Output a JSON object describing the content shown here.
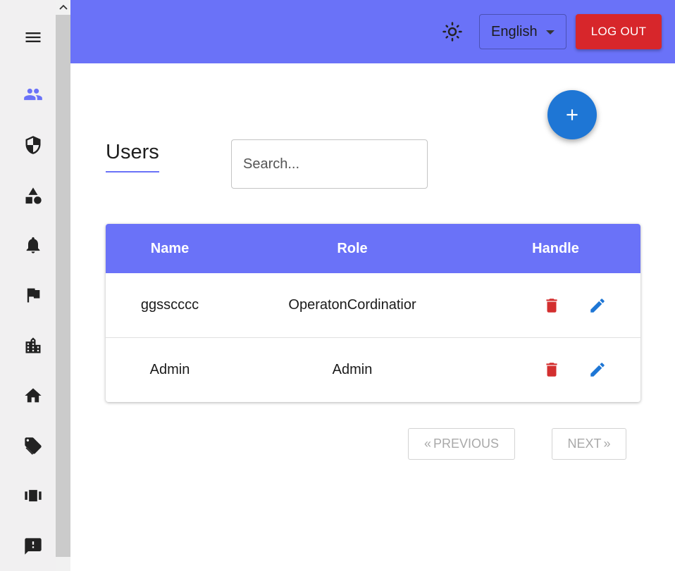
{
  "header": {
    "language": "English",
    "logout_label": "LOG OUT"
  },
  "sidebar": {
    "items": [
      {
        "icon": "menu-icon"
      },
      {
        "icon": "users-icon",
        "active": true
      },
      {
        "icon": "shield-icon"
      },
      {
        "icon": "shapes-icon"
      },
      {
        "icon": "bell-icon"
      },
      {
        "icon": "flag-icon"
      },
      {
        "icon": "city-icon"
      },
      {
        "icon": "home-icon"
      },
      {
        "icon": "tags-icon"
      },
      {
        "icon": "badge-icon"
      },
      {
        "icon": "feedback-icon"
      }
    ]
  },
  "page": {
    "title": "Users",
    "search_placeholder": "Search..."
  },
  "table": {
    "headers": {
      "name": "Name",
      "role": "Role",
      "handle": "Handle"
    },
    "rows": [
      {
        "name": "ggsscccc",
        "role": "OperatonCordinatior"
      },
      {
        "name": "Admin",
        "role": "Admin"
      }
    ]
  },
  "pagination": {
    "prev_label": "PREVIOUS",
    "next_label": "NEXT"
  },
  "colors": {
    "accent": "#6a72f8",
    "logout": "#d7262b",
    "fab": "#1e76d5",
    "delete": "#d32f2f",
    "edit": "#1e76d5"
  }
}
